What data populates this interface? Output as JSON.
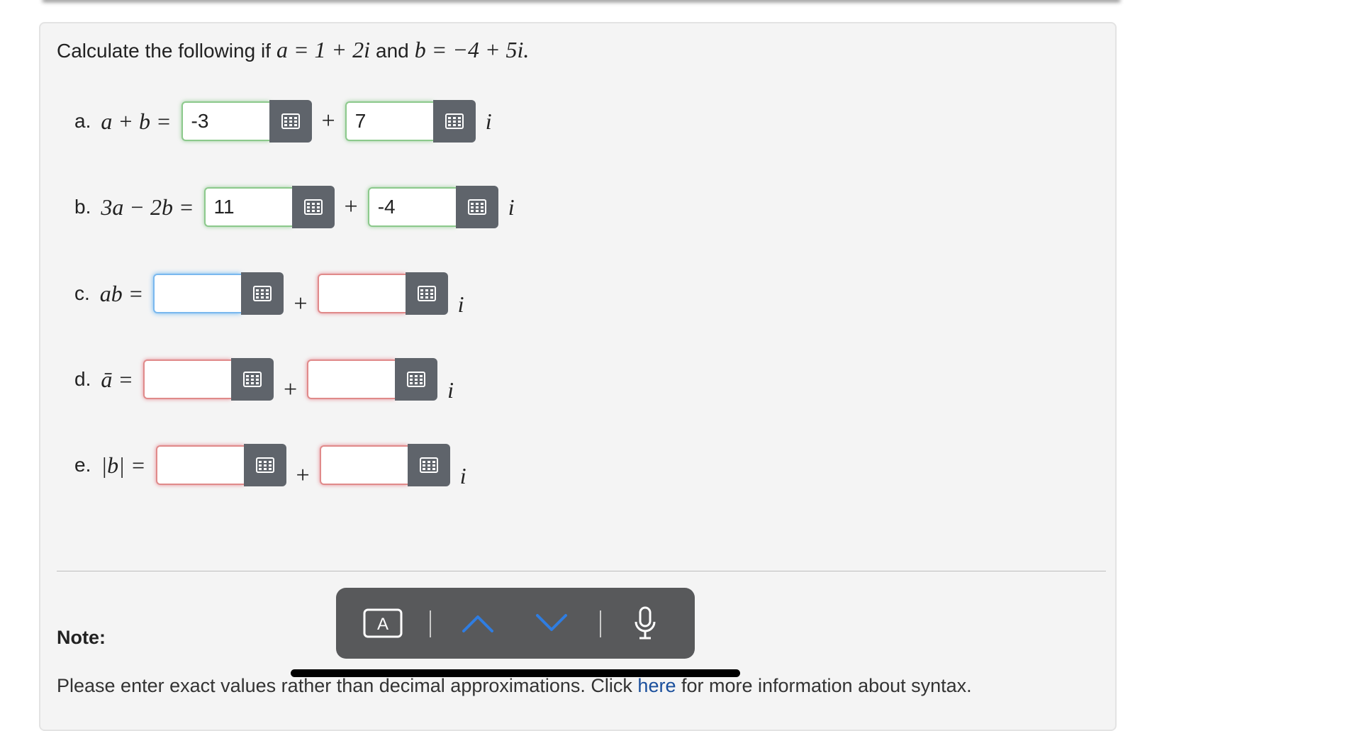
{
  "prompt": {
    "lead": "Calculate the following if",
    "a_def": "a = 1 + 2i",
    "conj": "and",
    "b_def": "b = −4 + 5i."
  },
  "parts": [
    {
      "label": "a.",
      "expression": "a + b =",
      "real": "-3",
      "imag": "7",
      "real_state": "correct",
      "imag_state": "correct"
    },
    {
      "label": "b.",
      "expression": "3a − 2b =",
      "real": "11",
      "imag": "-4",
      "real_state": "correct",
      "imag_state": "correct"
    },
    {
      "label": "c.",
      "expression": "ab =",
      "real": "",
      "imag": "",
      "real_state": "focused",
      "imag_state": "incorrect"
    },
    {
      "label": "d.",
      "expression": "ā =",
      "real": "",
      "imag": "",
      "real_state": "incorrect",
      "imag_state": "incorrect"
    },
    {
      "label": "e.",
      "expression": "|b| =",
      "real": "",
      "imag": "",
      "real_state": "incorrect",
      "imag_state": "incorrect"
    }
  ],
  "plus_sign": "+",
  "imag_unit": "i",
  "note": {
    "label": "Note:",
    "text_before": "Please enter exact values rather than decimal approximations. Click",
    "link": "here",
    "text_after": "for more information about syntax."
  },
  "toolbar": {
    "format_key": "A"
  },
  "colors": {
    "correct": "#8cc98c",
    "incorrect": "#e08a8a",
    "focused": "#7ab8ee",
    "chevron": "#2f7de1",
    "grid_button": "#5f646b"
  }
}
